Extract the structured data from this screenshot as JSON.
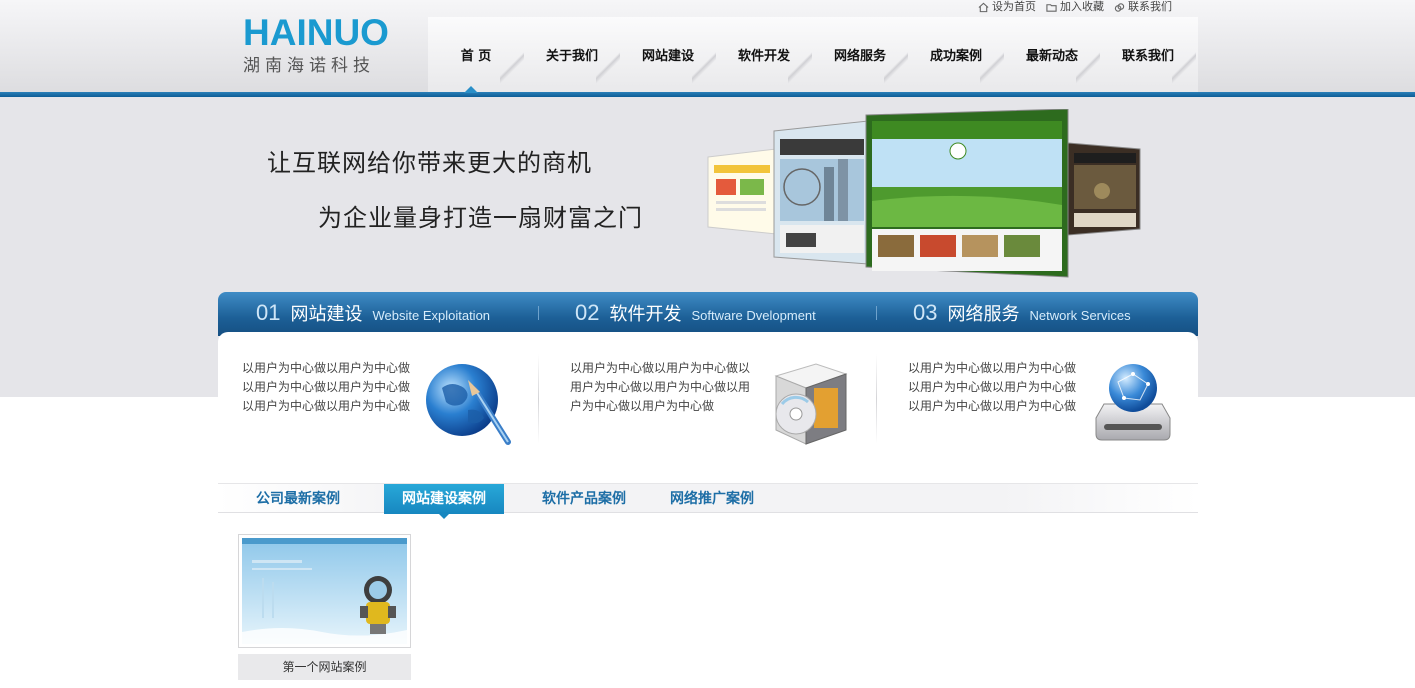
{
  "header": {
    "logo_en": "HAINUO",
    "logo_cn": "湖南海诺科技",
    "toplinks": [
      {
        "label": "设为首页",
        "icon": "home-icon"
      },
      {
        "label": "加入收藏",
        "icon": "folder-icon"
      },
      {
        "label": "联系我们",
        "icon": "link-icon"
      }
    ],
    "nav": [
      "首 页",
      "关于我们",
      "网站建设",
      "软件开发",
      "网络服务",
      "成功案例",
      "最新动态",
      "联系我们"
    ]
  },
  "banner": {
    "slogan_1": "让互联网给你带来更大的商机",
    "slogan_2": "为企业量身打造一扇财富之门"
  },
  "services": [
    {
      "num": "01",
      "title": "网站建设",
      "en": "Website Exploitation",
      "text": "以用户为中心做以用户为中心做以用户为中心做以用户为中心做以用户为中心做以用户为中心做",
      "icon": "globe-brush-icon"
    },
    {
      "num": "02",
      "title": "软件开发",
      "en": "Software Dvelopment",
      "text": "以用户为中心做以用户为中心做以用户为中心做以用户为中心做以用户为中心做以用户为中心做",
      "icon": "software-box-icon"
    },
    {
      "num": "03",
      "title": "网络服务",
      "en": "Network Services",
      "text": "以用户为中心做以用户为中心做以用户为中心做以用户为中心做以用户为中心做以用户为中心做",
      "icon": "network-drive-icon"
    }
  ],
  "case_tabs": [
    "公司最新案例",
    "网站建设案例",
    "软件产品案例",
    "网络推广案例"
  ],
  "active_case_tab": "网站建设案例",
  "cases": [
    {
      "caption": "第一个网站案例"
    }
  ],
  "colors": {
    "brand_blue": "#1a9ad0",
    "header_bar": "#0d5d96",
    "service_head": "#1c5f96",
    "tab_active": "#1787c0",
    "tab_text": "#1d6ea6"
  }
}
